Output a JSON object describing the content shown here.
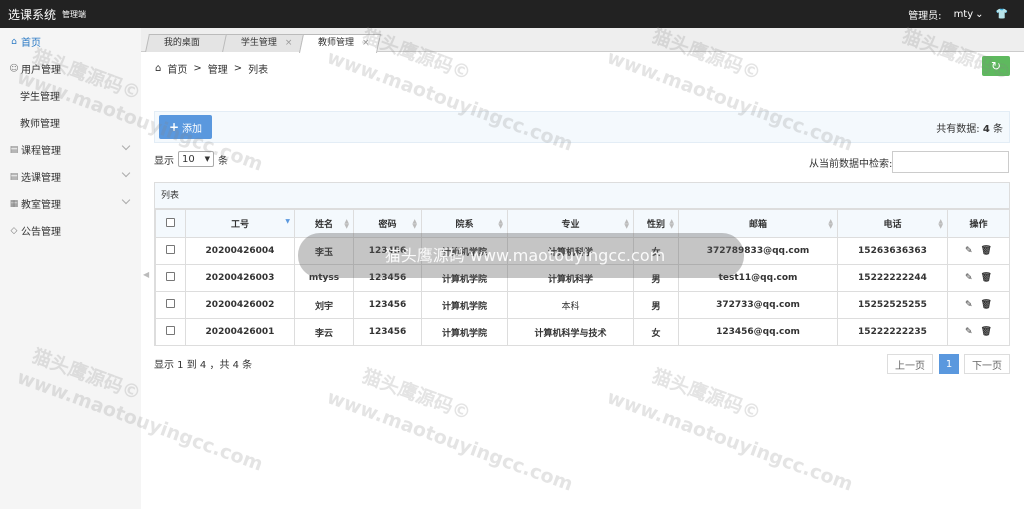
{
  "header": {
    "title": "选课系统",
    "subtitle": "管理端",
    "admin_label": "管理员:",
    "admin_name": "mty",
    "shirt_icon": "shirt-icon"
  },
  "sidebar": {
    "items": [
      {
        "label": "首页",
        "icon": "home-icon"
      },
      {
        "label": "用户管理",
        "icon": "user-icon"
      },
      {
        "label": "学生管理",
        "icon": ""
      },
      {
        "label": "教师管理",
        "icon": ""
      },
      {
        "label": "课程管理",
        "icon": "book-icon"
      },
      {
        "label": "选课管理",
        "icon": "list-icon"
      },
      {
        "label": "教室管理",
        "icon": "room-icon"
      },
      {
        "label": "公告管理",
        "icon": "tag-icon"
      }
    ]
  },
  "tabs": [
    {
      "label": "我的桌面"
    },
    {
      "label": "学生管理",
      "close": "×"
    },
    {
      "label": "教师管理",
      "close": "×"
    }
  ],
  "breadcrumb": {
    "home": "首页",
    "sep": ">",
    "level1": "管理",
    "level2": "列表"
  },
  "toolbar": {
    "add_label": "添加",
    "total_prefix": "共有数据:",
    "total_count": "4",
    "total_suffix": "条"
  },
  "length": {
    "prefix": "显示",
    "value": "10",
    "suffix": "条"
  },
  "search": {
    "label": "从当前数据中检索:",
    "value": ""
  },
  "table": {
    "panel_title": "列表",
    "columns": [
      "工号",
      "姓名",
      "密码",
      "院系",
      "专业",
      "性别",
      "邮箱",
      "电话",
      "操作"
    ],
    "rows": [
      {
        "id": "20200426004",
        "name": "李玉",
        "pwd": "123456",
        "dept": "计算机学院",
        "major": "计算机科学",
        "gender": "女",
        "email": "372789833@qq.com",
        "phone": "15263636363"
      },
      {
        "id": "20200426003",
        "name": "mtyss",
        "pwd": "123456",
        "dept": "计算机学院",
        "major": "计算机科学",
        "gender": "男",
        "email": "test11@qq.com",
        "phone": "15222222244"
      },
      {
        "id": "20200426002",
        "name": "刘宇",
        "pwd": "123456",
        "dept": "计算机学院",
        "major": "本科",
        "gender": "男",
        "email": "372733@qq.com",
        "phone": "15252525255"
      },
      {
        "id": "20200426001",
        "name": "李云",
        "pwd": "123456",
        "dept": "计算机学院",
        "major": "计算机科学与技术",
        "gender": "女",
        "email": "123456@qq.com",
        "phone": "15222222235"
      }
    ]
  },
  "info": "显示 1 到 4 ，共 4 条",
  "pagination": {
    "prev": "上一页",
    "current": "1",
    "next": "下一页"
  },
  "overlay_text": "猫头鹰源码 www.maotouyingcc.com",
  "watermark": {
    "cn": "猫头鹰源码©",
    "url": "www.maotouyingcc.com"
  }
}
